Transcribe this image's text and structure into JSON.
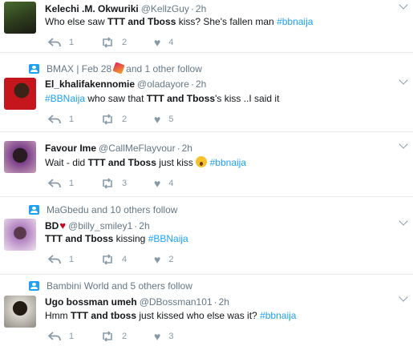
{
  "tweets": [
    {
      "name": "Kelechi .M. Okwuriki",
      "handle": "@KellzGuy",
      "time": "2h",
      "text_pre": "Who else saw ",
      "text_bold": "TTT and Tboss",
      "text_post": " kiss? She's fallen man ",
      "hashtag": "#bbnaija",
      "replies": "1",
      "retweets": "2",
      "likes": "4"
    },
    {
      "context": "BMAX | Feb 28",
      "context_suffix": "and 1 other follow",
      "name": "El_khalifakennomie",
      "handle": "@oladayore",
      "time": "2h",
      "hashtag": "#BBNaija",
      "text_pre": " who saw that ",
      "text_bold": "TTT and Tboss",
      "text_post": "'s kiss ..I said it",
      "replies": "1",
      "retweets": "2",
      "likes": "5"
    },
    {
      "name": "Favour Ime",
      "handle": "@CallMeFlayvour",
      "time": "2h",
      "text_pre": "Wait - did ",
      "text_bold": "TTT and Tboss",
      "text_post": " just kiss",
      "hashtag": "#bbnaija",
      "replies": "1",
      "retweets": "3",
      "likes": "4"
    },
    {
      "context": "MaGbedu and 10 others follow",
      "name": "BD",
      "handle": "@billy_smiley1",
      "time": "2h",
      "text_bold": "TTT and Tboss",
      "text_post": " kissing ",
      "hashtag": "#BBNaija",
      "replies": "1",
      "retweets": "4",
      "likes": "2"
    },
    {
      "context": "Bambini World and 5 others follow",
      "name": "Ugo bossman umeh",
      "handle": "@DBossman101",
      "time": "2h",
      "text_pre": "Hmm ",
      "text_bold": "TTT and tboss",
      "text_post": " just kissed who else was it? ",
      "hashtag": "#bbnaija",
      "replies": "1",
      "retweets": "2",
      "likes": "3"
    }
  ],
  "colors": {
    "accent": "#1da1f2",
    "muted": "#657786",
    "divider": "#e6ecf0"
  },
  "icons": {
    "reply": "reply-icon",
    "retweet": "retweet-icon",
    "like": "heart-icon",
    "menu": "chevron-down-icon",
    "context": "people-icon"
  }
}
